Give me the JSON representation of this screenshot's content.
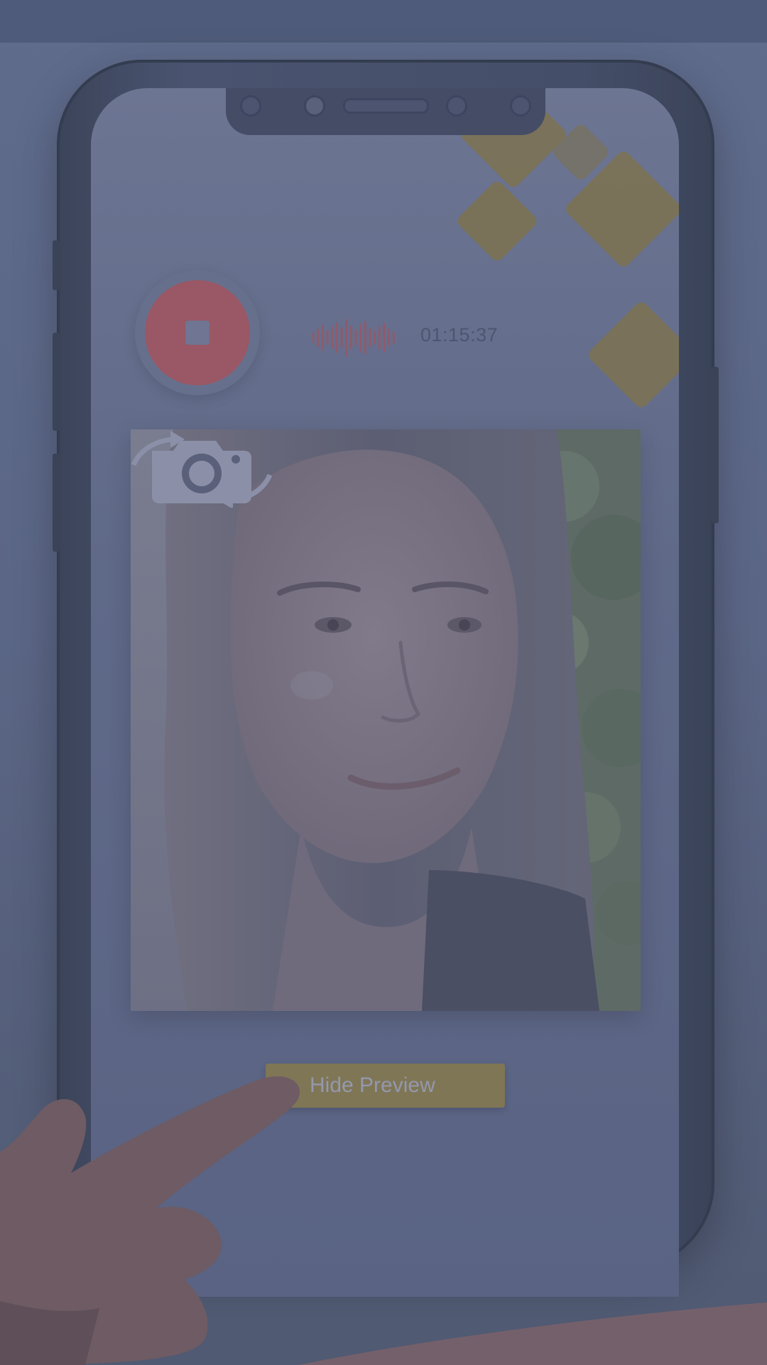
{
  "recording": {
    "status": "recording",
    "timer": "01:15:37"
  },
  "controls": {
    "stop_icon": "stop-icon",
    "waveform_icon": "audio-waveform-icon",
    "switch_camera_icon": "camera-switch-icon"
  },
  "preview": {
    "visible": true,
    "hide_button_label": "Hide Preview"
  },
  "colors": {
    "record_red": "#9a5765",
    "accent_gold": "#7f7655",
    "overlay": "#5b6686"
  }
}
